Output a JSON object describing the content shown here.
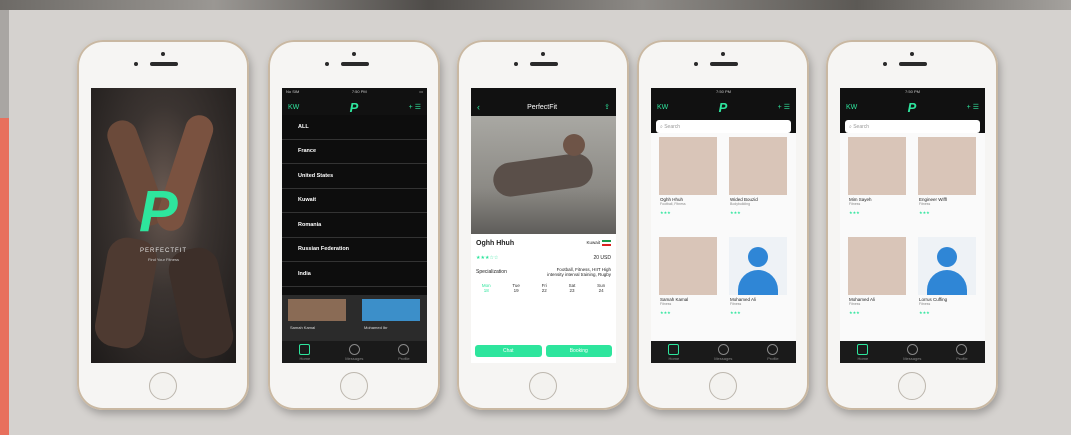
{
  "phone1": {
    "brand": "PERFECTFIT",
    "tagline": "Find Your Fitness"
  },
  "phone2": {
    "status_left": "No SIM",
    "status_time": "7:50 PM",
    "nav_left": "KW",
    "menu": [
      "ALL",
      "France",
      "United States",
      "Kuwait",
      "Romania",
      "Russian Federation",
      "India"
    ],
    "under_names": [
      "Samah Kamal",
      "Mohamed Ibr"
    ],
    "tabs": [
      "Home",
      "Messages",
      "Profile"
    ]
  },
  "phone3": {
    "title": "PerfectFit",
    "name": "Oghh Hhuh",
    "country": "Kuwait",
    "rating": "★★★☆☆",
    "price": "20 USD",
    "spec_label": "Specialization",
    "spec_value": "Football, Fitness, HIIT High intensity interval training, Rugby",
    "days": [
      "Mon",
      "Tue",
      "Fri",
      "Sat",
      "Sun"
    ],
    "day_nums": [
      "18",
      "19",
      "22",
      "23",
      "24"
    ],
    "btn_left": "Chat",
    "btn_right": "Booking"
  },
  "phone4": {
    "status_time": "7:50 PM",
    "nav_left": "KW",
    "search": "Search",
    "cards": [
      {
        "name": "Oghh Hhuh",
        "meta": "Football, Fitness",
        "stars": "★★★"
      },
      {
        "name": "Wided Bouzid",
        "meta": "Bodybuilding",
        "stars": "★★★"
      },
      {
        "name": "Samah Kamal",
        "meta": "Fitness",
        "stars": "★★★"
      },
      {
        "name": "Mohamed Ali",
        "meta": "Fitness",
        "stars": "★★★"
      }
    ],
    "tabs": [
      "Home",
      "Messages",
      "Profile"
    ]
  },
  "phone5": {
    "status_time": "7:50 PM",
    "nav_left": "KW",
    "search": "Search",
    "cards": [
      {
        "name": "Mim Sayeh",
        "meta": "Fitness",
        "stars": "★★★"
      },
      {
        "name": "Engineer Wiffl",
        "meta": "Fitness",
        "stars": "★★★"
      },
      {
        "name": "Mohamed Ali",
        "meta": "Fitness",
        "stars": "★★★"
      },
      {
        "name": "Lorrus Cuffing",
        "meta": "Fitness",
        "stars": "★★★"
      }
    ],
    "tabs": [
      "Home",
      "Messages",
      "Profile"
    ]
  }
}
